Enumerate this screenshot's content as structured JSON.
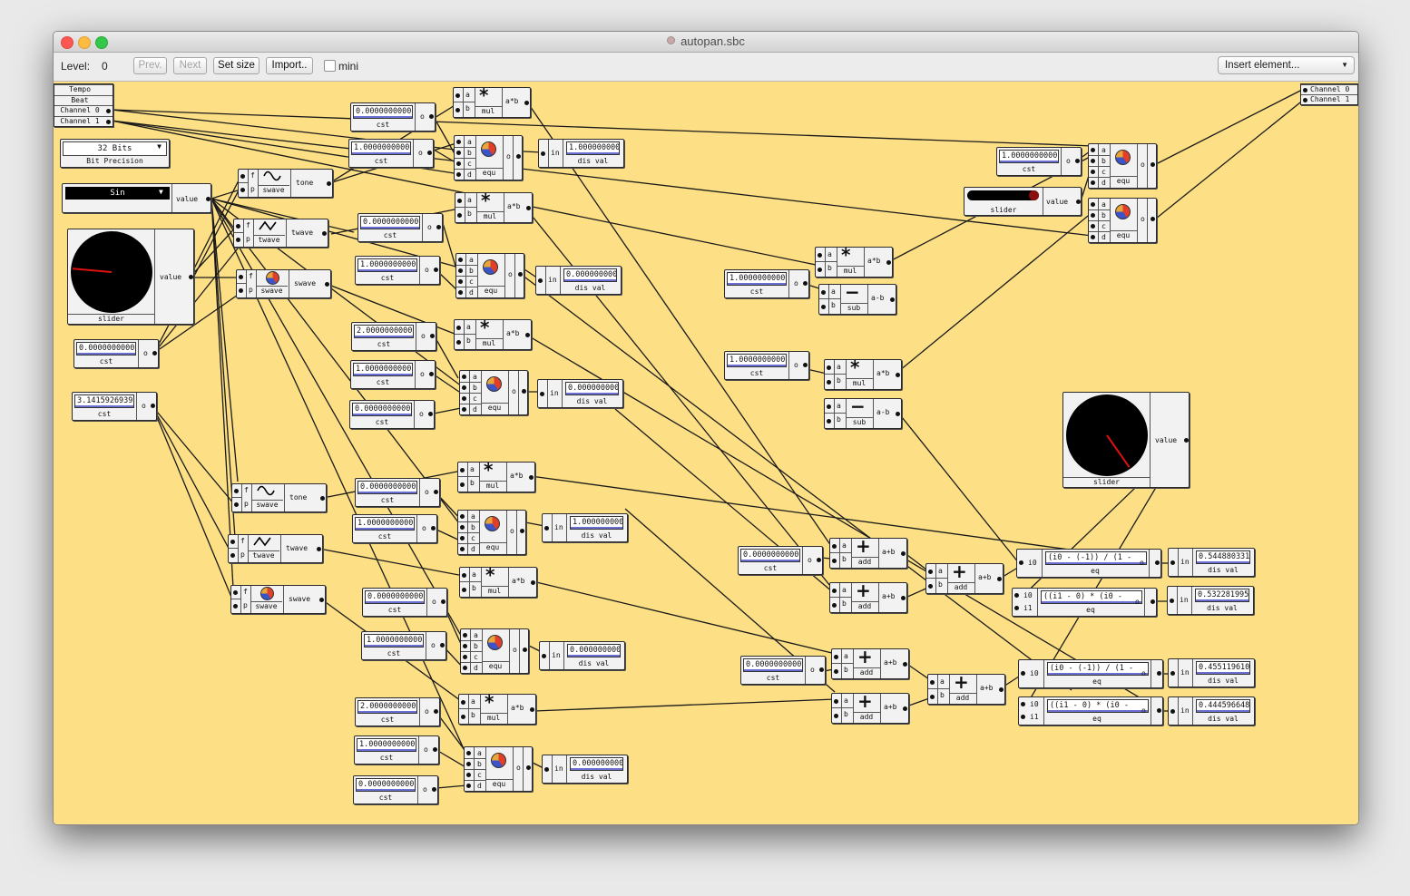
{
  "window": {
    "title": "autopan.sbc"
  },
  "toolbar": {
    "level_label": "Level:",
    "level_value": "0",
    "prev_label": "Prev.",
    "next_label": "Next",
    "set_size_label": "Set size",
    "import_label": "Import..",
    "mini_label": "mini",
    "insert_label": "Insert element..."
  },
  "inputs": [
    "Tempo",
    "Beat",
    "Channel 0",
    "Channel 1"
  ],
  "outputs": [
    "Channel 0",
    "Channel 1"
  ],
  "bits": {
    "value": "32 Bits",
    "label": "Bit Precision"
  },
  "wave_selector": {
    "value": "Sin",
    "port": "value"
  },
  "dial_left": {
    "label": "slider",
    "port": "value"
  },
  "dial_right": {
    "label": "slider",
    "port": "value"
  },
  "hslider": {
    "label": "slider",
    "port": "value"
  },
  "cst_left_1": {
    "value": "0.0000000000",
    "label": "cst"
  },
  "cst_pi": {
    "value": "3.1415926939",
    "label": "cst"
  },
  "consts": [
    {
      "value": "0.0000000000",
      "label": "cst"
    },
    {
      "value": "1.0000000000",
      "label": "cst"
    },
    {
      "value": "0.0000000000",
      "label": "cst"
    },
    {
      "value": "1.0000000000",
      "label": "cst"
    },
    {
      "value": "2.0000000000",
      "label": "cst"
    },
    {
      "value": "1.0000000000",
      "label": "cst"
    },
    {
      "value": "0.0000000000",
      "label": "cst"
    },
    {
      "value": "0.0000000000",
      "label": "cst"
    },
    {
      "value": "1.0000000000",
      "label": "cst"
    },
    {
      "value": "0.0000000000",
      "label": "cst"
    },
    {
      "value": "1.0000000000",
      "label": "cst"
    },
    {
      "value": "2.0000000000",
      "label": "cst"
    },
    {
      "value": "1.0000000000",
      "label": "cst"
    },
    {
      "value": "0.0000000000",
      "label": "cst"
    },
    {
      "value": "1.0000000000",
      "label": "cst"
    },
    {
      "value": "1.0000000000",
      "label": "cst"
    },
    {
      "value": "1.0000000000",
      "label": "cst"
    },
    {
      "value": "0.0000000000",
      "label": "cst"
    },
    {
      "value": "0.0000000000",
      "label": "cst"
    }
  ],
  "waves": [
    {
      "name": "tone",
      "sub": "swave",
      "ports": [
        "f",
        "p"
      ]
    },
    {
      "name": "twave",
      "sub": "twave",
      "ports": [
        "f",
        "p"
      ]
    },
    {
      "name": "swave",
      "sub": "swave",
      "ports": [
        "f",
        "p"
      ]
    },
    {
      "name": "tone",
      "sub": "swave",
      "ports": [
        "f",
        "p"
      ]
    },
    {
      "name": "twave",
      "sub": "twave",
      "ports": [
        "f",
        "p"
      ]
    },
    {
      "name": "swave",
      "sub": "swave",
      "ports": [
        "f",
        "p"
      ]
    }
  ],
  "muls": [
    {
      "sym": "*",
      "name": "mul",
      "out": "a*b",
      "ports": [
        "a",
        "b"
      ]
    },
    {
      "sym": "*",
      "name": "mul",
      "out": "a*b",
      "ports": [
        "a",
        "b"
      ]
    },
    {
      "sym": "*",
      "name": "mul",
      "out": "a*b",
      "ports": [
        "a",
        "b"
      ]
    },
    {
      "sym": "*",
      "name": "mul",
      "out": "a*b",
      "ports": [
        "a",
        "b"
      ]
    },
    {
      "sym": "*",
      "name": "mul",
      "out": "a*b",
      "ports": [
        "a",
        "b"
      ]
    },
    {
      "sym": "*",
      "name": "mul",
      "out": "a*b",
      "ports": [
        "a",
        "b"
      ]
    },
    {
      "sym": "*",
      "name": "mul",
      "out": "a*b",
      "ports": [
        "a",
        "b"
      ]
    },
    {
      "sym": "*",
      "name": "mul",
      "out": "a*b",
      "ports": [
        "a",
        "b"
      ]
    }
  ],
  "subs": [
    {
      "sym": "−",
      "name": "sub",
      "out": "a-b",
      "ports": [
        "a",
        "b"
      ]
    },
    {
      "sym": "−",
      "name": "sub",
      "out": "a-b",
      "ports": [
        "a",
        "b"
      ]
    }
  ],
  "adds": [
    {
      "sym": "+",
      "name": "add",
      "out": "a+b",
      "ports": [
        "a",
        "b"
      ]
    },
    {
      "sym": "+",
      "name": "add",
      "out": "a+b",
      "ports": [
        "a",
        "b"
      ]
    },
    {
      "sym": "+",
      "name": "add",
      "out": "a+b",
      "ports": [
        "a",
        "b"
      ]
    },
    {
      "sym": "+",
      "name": "add",
      "out": "a+b",
      "ports": [
        "a",
        "b"
      ]
    },
    {
      "sym": "+",
      "name": "add",
      "out": "a+b",
      "ports": [
        "a",
        "b"
      ]
    },
    {
      "sym": "+",
      "name": "add",
      "out": "a+b",
      "ports": [
        "a",
        "b"
      ]
    }
  ],
  "equs": [
    {
      "name": "equ",
      "ports": [
        "a",
        "b",
        "c",
        "d"
      ]
    },
    {
      "name": "equ",
      "ports": [
        "a",
        "b",
        "c",
        "d"
      ]
    },
    {
      "name": "equ",
      "ports": [
        "a",
        "b",
        "c",
        "d"
      ]
    },
    {
      "name": "equ",
      "ports": [
        "a",
        "b",
        "c",
        "d"
      ]
    },
    {
      "name": "equ",
      "ports": [
        "a",
        "b",
        "c",
        "d"
      ]
    },
    {
      "name": "equ",
      "ports": [
        "a",
        "b",
        "c",
        "d"
      ]
    },
    {
      "name": "equ",
      "ports": [
        "a",
        "b",
        "c",
        "d"
      ]
    },
    {
      "name": "equ",
      "ports": [
        "a",
        "b",
        "c",
        "d"
      ]
    }
  ],
  "disvals": [
    {
      "value": "1.000000000",
      "label": "dis val",
      "port": "in"
    },
    {
      "value": "0.000000000",
      "label": "dis val",
      "port": "in"
    },
    {
      "value": "0.000000000",
      "label": "dis val",
      "port": "in"
    },
    {
      "value": "1.000000000",
      "label": "dis val",
      "port": "in"
    },
    {
      "value": "0.000000000",
      "label": "dis val",
      "port": "in"
    },
    {
      "value": "0.000000000",
      "label": "dis val",
      "port": "in"
    },
    {
      "value": "0.544880331",
      "label": "dis val",
      "port": "in"
    },
    {
      "value": "0.532281995",
      "label": "dis val",
      "port": "in"
    },
    {
      "value": "0.455119610",
      "label": "dis val",
      "port": "in"
    },
    {
      "value": "0.444596648",
      "label": "dis val",
      "port": "in"
    }
  ],
  "eqs": [
    {
      "expr": "(i0 - (-1)) / (1 -",
      "label": "eq",
      "ports": [
        "i0"
      ]
    },
    {
      "expr": "((i1 - 0) * (i0 -",
      "label": "eq",
      "ports": [
        "i0",
        "i1"
      ]
    },
    {
      "expr": "(i0 - (-1)) / (1 -",
      "label": "eq",
      "ports": [
        "i0"
      ]
    },
    {
      "expr": "((i1 - 0) * (i0 -",
      "label": "eq",
      "ports": [
        "i0",
        "i1"
      ]
    }
  ],
  "colors": {
    "canvas": "#fde085",
    "node": "#f2f2f2",
    "wire": "#1a1a1a",
    "value_underline": "#6a6fd1",
    "needle": "#e01010"
  }
}
